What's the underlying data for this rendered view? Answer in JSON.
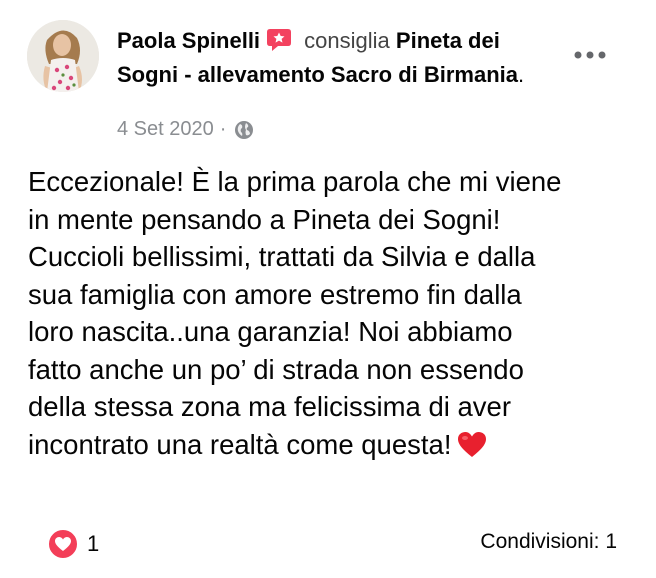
{
  "post": {
    "author_name": "Paola Spinelli",
    "verb": "consiglia",
    "page_name": "Pineta dei Sogni - allevamento Sacro di Birmania",
    "header_end": ".",
    "date": "4 Set 2020",
    "separator": "·",
    "privacy_icon": "globe-icon",
    "more_icon": "more-options-icon",
    "body_text": "Eccezionale! È la prima parola che mi viene\nin mente pensando a Pineta dei Sogni!\nCuccioli bellissimi, trattati da Silvia e dalla\nsua famiglia con amore estremo fin dalla\nloro nascita..una garanzia! Noi abbiamo\nfatto anche un po’ di strada non essendo\ndella stessa zona ma felicissima di aver\nincontrato una realtà come questa!",
    "body_emoji": "red-heart-emoji",
    "reaction_icon": "love-reaction-icon",
    "reaction_count": "1",
    "shares_label": "Condivisioni: 1"
  },
  "colors": {
    "recommend_badge": "#f3425f",
    "love_reaction": "#f33e58",
    "meta_text": "#8a8d91",
    "text": "#050505"
  }
}
